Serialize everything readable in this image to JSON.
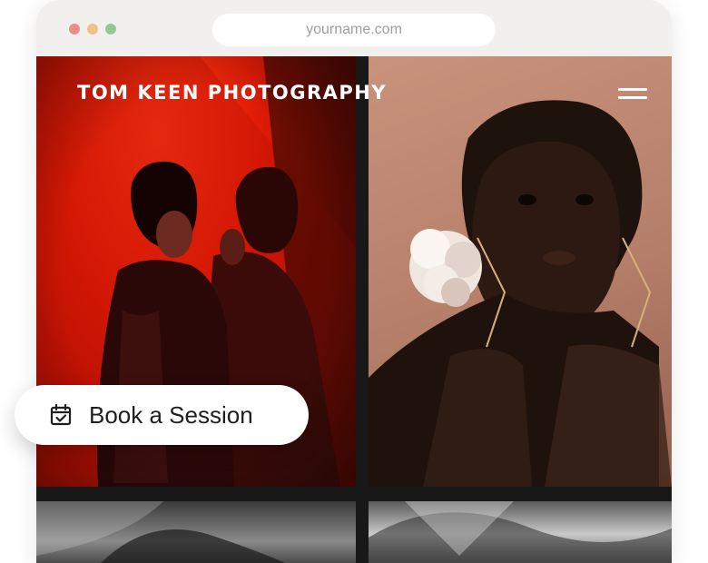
{
  "browser": {
    "url": "yourname.com",
    "window_controls": [
      "close",
      "minimize",
      "maximize"
    ]
  },
  "site": {
    "brand": "TOM KEEN PHOTOGRAPHY",
    "menu_icon": "hamburger-menu-icon"
  },
  "gallery": {
    "photos": [
      {
        "name": "photo-red-portrait"
      },
      {
        "name": "photo-flower-portrait"
      },
      {
        "name": "photo-bw-1"
      },
      {
        "name": "photo-bw-2"
      }
    ]
  },
  "cta": {
    "label": "Book a Session",
    "icon": "calendar-check-icon"
  },
  "colors": {
    "frame": "#f1f0ee",
    "accent_red": "#e11c06",
    "accent_skin": "#c9927b"
  }
}
